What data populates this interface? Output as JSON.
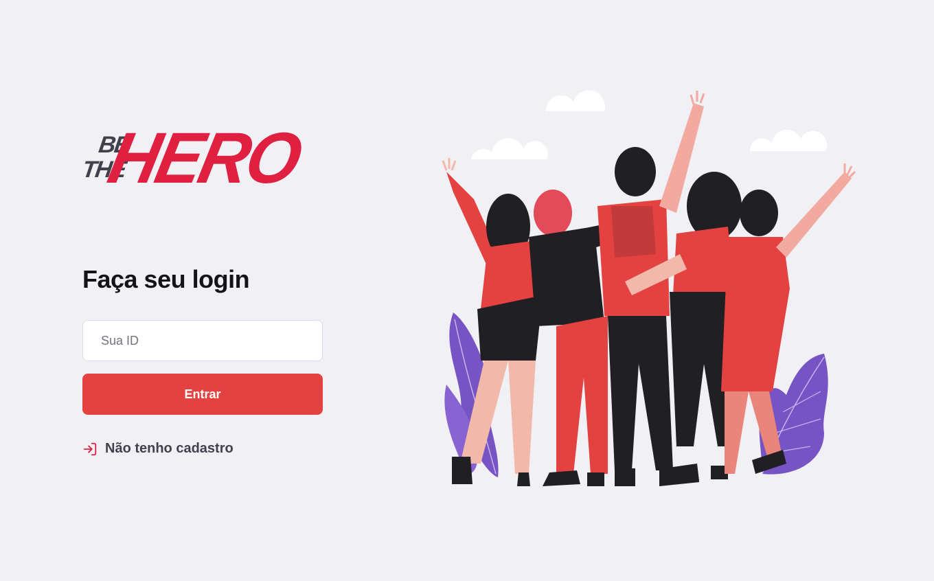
{
  "logo": {
    "line1": "BE",
    "line2": "THE",
    "word": "HERO"
  },
  "login": {
    "title": "Faça seu login",
    "id_placeholder": "Sua ID",
    "id_value": "",
    "submit_label": "Entrar",
    "register_link": "Não tenho cadastro"
  },
  "icons": {
    "register": "log-in-icon"
  },
  "colors": {
    "background": "#f0f0f5",
    "accent": "#e34240",
    "logo_red": "#e02041",
    "text_dark": "#13131a",
    "text_gray": "#41414d",
    "illustration_purple": "#7754c4"
  }
}
